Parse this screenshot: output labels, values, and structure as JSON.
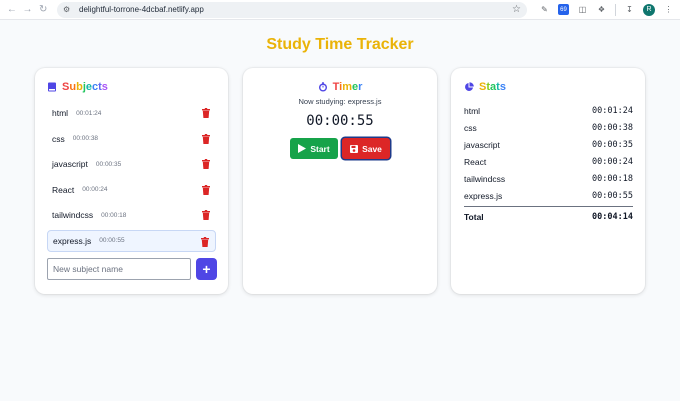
{
  "browser": {
    "url": "delightful-torrone-4dcbaf.netlify.app",
    "profile_initial": "R",
    "ext_badge": "69"
  },
  "page": {
    "title": "Study Time Tracker"
  },
  "subjects": {
    "heading_parts": [
      "S",
      "u",
      "b",
      "j",
      "e",
      "c",
      "t",
      "s"
    ],
    "heading_colors": [
      "#ef4444",
      "#f97316",
      "#eab308",
      "#22c55e",
      "#14b8a6",
      "#3b82f6",
      "#6366f1",
      "#a855f7"
    ],
    "items": [
      {
        "name": "html",
        "time": "00:01:24",
        "active": false
      },
      {
        "name": "css",
        "time": "00:00:38",
        "active": false
      },
      {
        "name": "javascript",
        "time": "00:00:35",
        "active": false
      },
      {
        "name": "React",
        "time": "00:00:24",
        "active": false
      },
      {
        "name": "tailwindcss",
        "time": "00:00:18",
        "active": false
      },
      {
        "name": "express.js",
        "time": "00:00:55",
        "active": true
      }
    ],
    "new_placeholder": "New subject name",
    "add_label": "+"
  },
  "timer": {
    "heading_parts": [
      "T",
      "i",
      "m",
      "e",
      "r"
    ],
    "heading_colors": [
      "#ef4444",
      "#f97316",
      "#eab308",
      "#22c55e",
      "#3b82f6"
    ],
    "now_studying": "Now studying: express.js",
    "clock": "00:00:55",
    "start_label": "Start",
    "save_label": "Save"
  },
  "stats": {
    "heading_parts": [
      "S",
      "t",
      "a",
      "t",
      "s"
    ],
    "heading_colors": [
      "#eab308",
      "#84cc16",
      "#22c55e",
      "#14b8a6",
      "#3b82f6"
    ],
    "rows": [
      {
        "name": "html",
        "time": "00:01:24"
      },
      {
        "name": "css",
        "time": "00:00:38"
      },
      {
        "name": "javascript",
        "time": "00:00:35"
      },
      {
        "name": "React",
        "time": "00:00:24"
      },
      {
        "name": "tailwindcss",
        "time": "00:00:18"
      },
      {
        "name": "express.js",
        "time": "00:00:55"
      }
    ],
    "total_label": "Total",
    "total_time": "00:04:14"
  },
  "colors": {
    "title": "#eab308",
    "trash": "#dc2626",
    "start": "#16a34a",
    "save": "#dc2626",
    "add": "#4f46e5"
  }
}
